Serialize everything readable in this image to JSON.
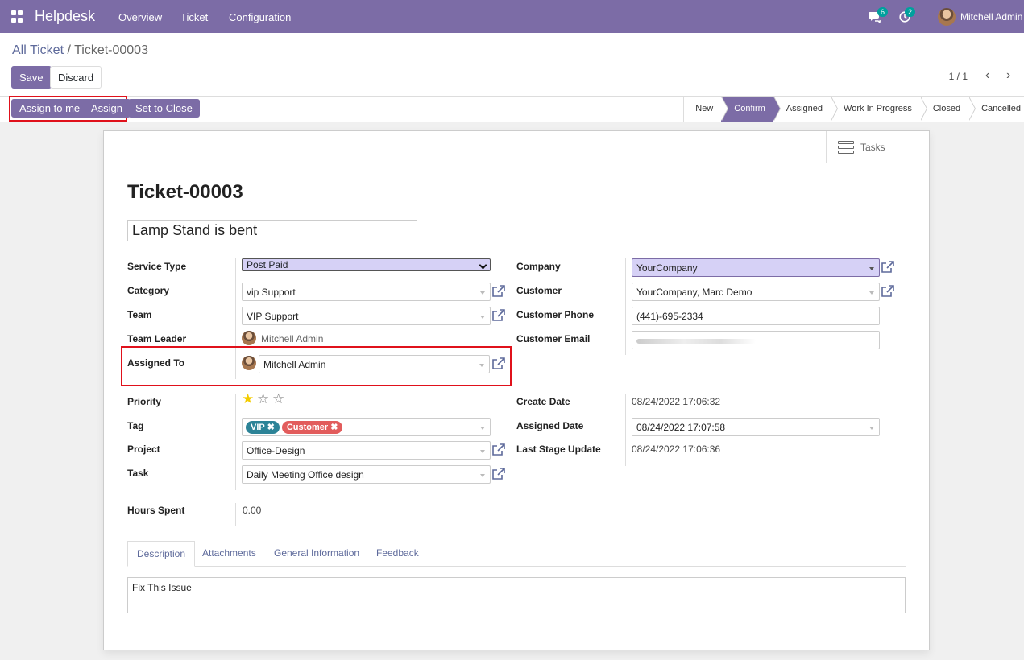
{
  "navbar": {
    "brand": "Helpdesk",
    "menu": [
      "Overview",
      "Ticket",
      "Configuration"
    ],
    "messages_badge": "6",
    "activities_badge": "2",
    "user": "Mitchell Admin"
  },
  "breadcrumb": {
    "parent": "All Ticket",
    "separator": "/",
    "current": "Ticket-00003"
  },
  "buttons": {
    "save": "Save",
    "discard": "Discard",
    "assign_to_me": "Assign to me",
    "assign": "Assign",
    "set_to_close": "Set to Close"
  },
  "pager": "1 / 1",
  "stages": [
    {
      "label": "New",
      "active": false
    },
    {
      "label": "Confirm",
      "active": true
    },
    {
      "label": "Assigned",
      "active": false
    },
    {
      "label": "Work In Progress",
      "active": false
    },
    {
      "label": "Closed",
      "active": false
    },
    {
      "label": "Cancelled",
      "active": false
    }
  ],
  "smart_button": "Tasks",
  "ticket": {
    "number": "Ticket-00003",
    "subject": "Lamp Stand is bent"
  },
  "left_fields": {
    "service_type": {
      "label": "Service Type",
      "value": "Post Paid"
    },
    "category": {
      "label": "Category",
      "value": "vip Support"
    },
    "team": {
      "label": "Team",
      "value": "VIP Support"
    },
    "team_leader": {
      "label": "Team Leader",
      "value": "Mitchell Admin"
    },
    "assigned_to": {
      "label": "Assigned To",
      "value": "Mitchell Admin"
    },
    "priority": {
      "label": "Priority",
      "stars_filled": 1,
      "stars_total": 3
    },
    "tag": {
      "label": "Tag",
      "tags": [
        {
          "name": "VIP",
          "color": "#2c8397"
        },
        {
          "name": "Customer",
          "color": "#e25c5c"
        }
      ]
    },
    "project": {
      "label": "Project",
      "value": "Office-Design"
    },
    "task": {
      "label": "Task",
      "value": "Daily Meeting Office design"
    },
    "hours_spent": {
      "label": "Hours Spent",
      "value": "0.00"
    }
  },
  "right_fields": {
    "company": {
      "label": "Company",
      "value": "YourCompany"
    },
    "customer": {
      "label": "Customer",
      "value": "YourCompany, Marc Demo"
    },
    "customer_phone": {
      "label": "Customer Phone",
      "value": "(441)-695-2334"
    },
    "customer_email": {
      "label": "Customer Email",
      "value": ""
    },
    "create_date": {
      "label": "Create Date",
      "value": "08/24/2022 17:06:32"
    },
    "assigned_date": {
      "label": "Assigned Date",
      "value": "08/24/2022 17:07:58"
    },
    "last_stage_update": {
      "label": "Last Stage Update",
      "value": "08/24/2022 17:06:36"
    }
  },
  "tabs": [
    {
      "label": "Description",
      "active": true
    },
    {
      "label": "Attachments",
      "active": false
    },
    {
      "label": "General Information",
      "active": false
    },
    {
      "label": "Feedback",
      "active": false
    }
  ],
  "description": "Fix This Issue",
  "colors": {
    "brand": "#7c6ca6",
    "highlight": "#e0111b",
    "star": "#f3cc00"
  }
}
